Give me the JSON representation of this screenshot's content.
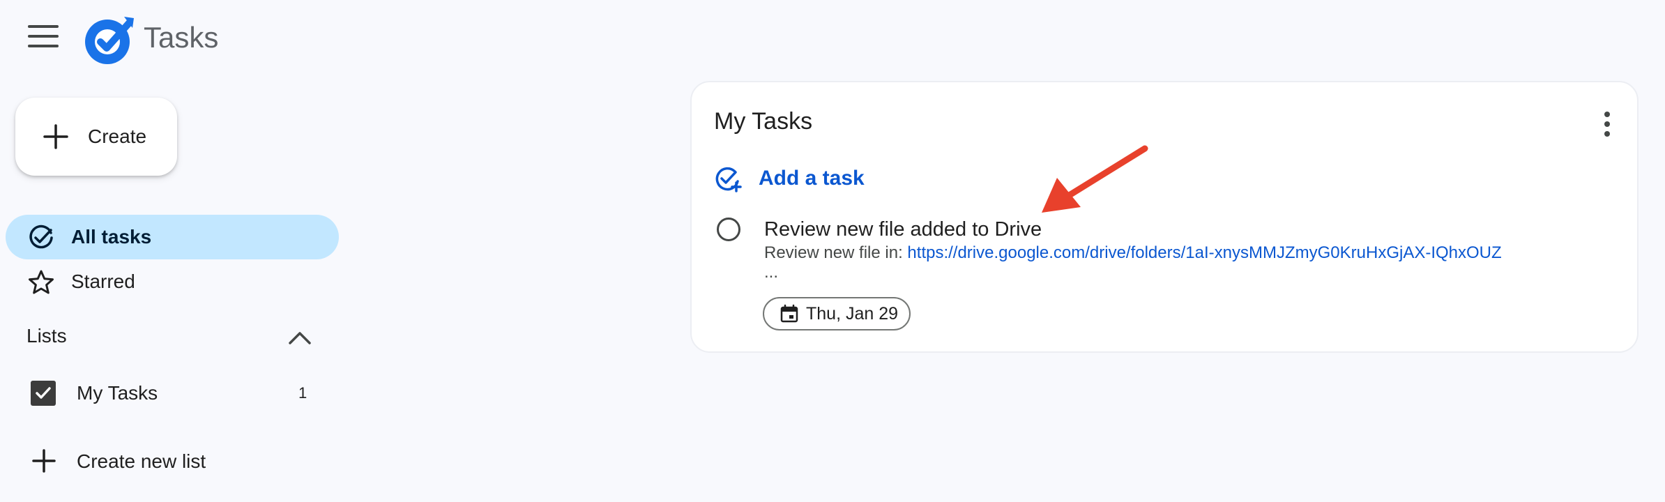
{
  "app": {
    "title": "Tasks"
  },
  "sidebar": {
    "create_label": "Create",
    "nav": [
      {
        "label": "All tasks",
        "icon": "task-alt-icon",
        "active": true
      },
      {
        "label": "Starred",
        "icon": "star-icon",
        "active": false
      }
    ],
    "lists_header": "Lists",
    "lists": [
      {
        "label": "My Tasks",
        "count": "1",
        "checked": true
      }
    ],
    "create_list_label": "Create new list"
  },
  "main": {
    "list_title": "My Tasks",
    "add_task_label": "Add a task",
    "tasks": [
      {
        "title": "Review new file added to Drive",
        "desc_prefix": "Review new file in: ",
        "desc_link": "https://drive.google.com/drive/folders/1aI-xnysMMJZmyG0KruHxGjAX-IQhxOUZ",
        "more": "...",
        "date": "Thu, Jan 29"
      }
    ]
  },
  "colors": {
    "accent": "#0b57d0",
    "active_nav": "#c2e7ff",
    "annotation_arrow": "#e8412c",
    "background": "#f8f9fd"
  }
}
